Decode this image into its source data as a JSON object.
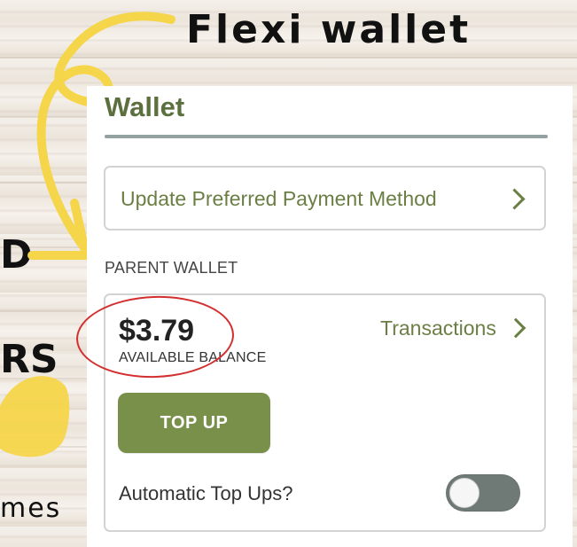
{
  "annotation": {
    "headline": "Flexi wallet",
    "left_fragments": [
      "D",
      "RS",
      "mes"
    ]
  },
  "app": {
    "title": "Wallet",
    "update_payment": {
      "label": "Update Preferred Payment Method",
      "icon": "chevron-right-icon"
    },
    "section": {
      "label": "PARENT WALLET"
    },
    "wallet": {
      "balance": "$3.79",
      "balance_label": "AVAILABLE BALANCE",
      "transactions_label": "Transactions",
      "transactions_icon": "chevron-right-icon",
      "topup_label": "TOP UP",
      "auto_topups_label": "Automatic Top Ups?",
      "auto_topups_enabled": false
    }
  },
  "colors": {
    "brand_green": "#78904a",
    "text_green": "#6b7f45",
    "title_green": "#5c6f3f",
    "yellow_annotation": "#f5d54a",
    "red_annotation": "#d32f2f"
  }
}
